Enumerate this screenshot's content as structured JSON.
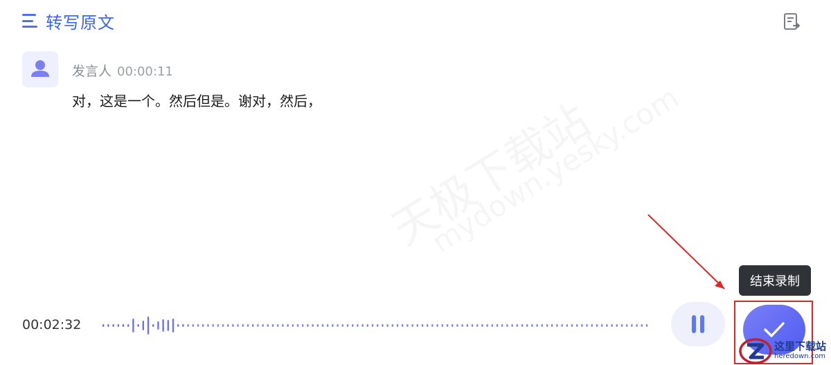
{
  "header": {
    "title": "转写原文",
    "menu_icon": "menu-icon",
    "export_icon": "export-document-icon"
  },
  "transcript": {
    "entries": [
      {
        "speaker": "发言人",
        "timestamp": "00:00:11",
        "text": "对，这是一个。然后但是。谢对，然后，",
        "avatar_icon": "user-avatar-icon"
      }
    ]
  },
  "watermark": {
    "cn": "天极下载站",
    "en": "mydown.yesky.com"
  },
  "recorder": {
    "elapsed": "00:02:32",
    "pause_icon": "pause-icon",
    "finish_icon": "check-icon",
    "finish_tooltip": "结束录制",
    "accent_color": "#4f6ef7"
  },
  "site_badge": {
    "name": "这里下载站",
    "url": "heredown.com"
  }
}
